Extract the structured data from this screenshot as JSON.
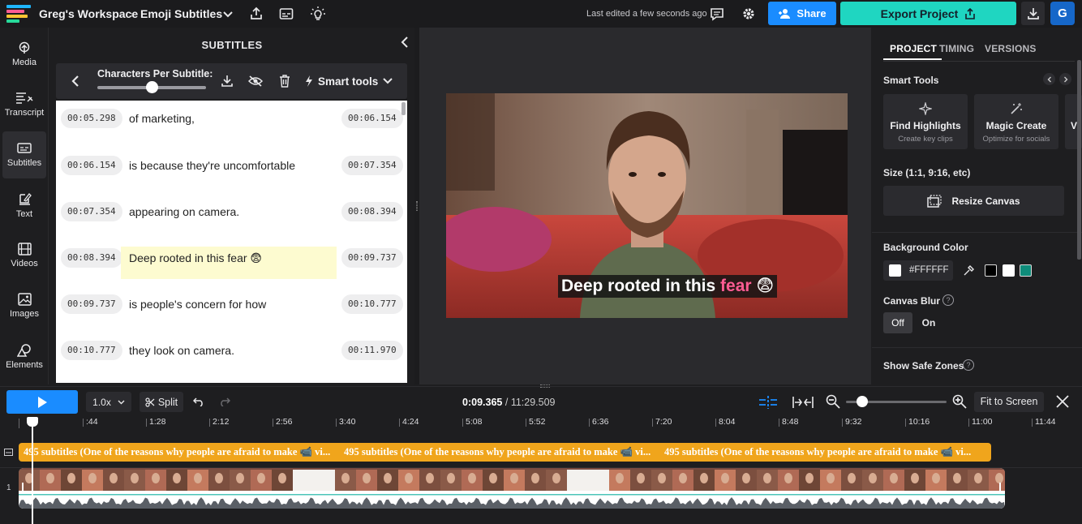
{
  "topbar": {
    "workspace": "Greg's Workspace",
    "separator": "›",
    "project_name": "Emoji Subtitles",
    "last_edited": "Last edited a few seconds ago",
    "share_label": "Share",
    "export_label": "Export Project",
    "avatar_letter": "G"
  },
  "rail": [
    {
      "label": "Media",
      "icon": "upload-icon"
    },
    {
      "label": "Transcript",
      "icon": "transcript-icon"
    },
    {
      "label": "Subtitles",
      "icon": "subtitles-icon"
    },
    {
      "label": "Text",
      "icon": "text-edit-icon"
    },
    {
      "label": "Videos",
      "icon": "film-icon"
    },
    {
      "label": "Images",
      "icon": "image-icon"
    },
    {
      "label": "Elements",
      "icon": "shapes-icon"
    }
  ],
  "subtitles_panel": {
    "title": "SUBTITLES",
    "chars_label": "Characters Per Subtitle:",
    "chars_slider_value": 0.5,
    "smart_tools_label": "Smart tools",
    "rows": [
      {
        "start": "00:05.298",
        "text": "of marketing,",
        "end": "00:06.154",
        "highlighted": false
      },
      {
        "start": "00:06.154",
        "text": "is because they're uncomfortable",
        "end": "00:07.354",
        "highlighted": false
      },
      {
        "start": "00:07.354",
        "text": "appearing on camera.",
        "end": "00:08.394",
        "highlighted": false
      },
      {
        "start": "00:08.394",
        "text": "Deep rooted in this fear 😨",
        "end": "00:09.737",
        "highlighted": true
      },
      {
        "start": "00:09.737",
        "text": "is people's concern for how",
        "end": "00:10.777",
        "highlighted": false
      },
      {
        "start": "00:10.777",
        "text": "they look on camera.",
        "end": "00:11.970",
        "highlighted": false
      }
    ]
  },
  "preview": {
    "caption_main": "Deep rooted in this",
    "caption_emph": "fear",
    "caption_emoji": "😨",
    "emph_color": "#ff5c93"
  },
  "right_panel": {
    "tabs": [
      "PROJECT",
      "TIMING",
      "VERSIONS"
    ],
    "active_tab": "PROJECT",
    "smart_tools_title": "Smart Tools",
    "cards": [
      {
        "title": "Find Highlights",
        "subtitle": "Create key clips",
        "icon": "sparkle-icon"
      },
      {
        "title": "Magic Create",
        "subtitle": "Optimize for socials",
        "icon": "magic-wand-icon"
      }
    ],
    "size_title": "Size (1:1, 9:16, etc)",
    "resize_label": "Resize Canvas",
    "bg_title": "Background Color",
    "bg_value": "#FFFFFF",
    "swatches": [
      "#000000",
      "#ffffff",
      "#0e8c7a"
    ],
    "blur_title": "Canvas Blur",
    "blur_off": "Off",
    "blur_on": "On",
    "safe_zones_title": "Show Safe Zones"
  },
  "timeline": {
    "speed": "1.0x",
    "split_label": "Split",
    "current_time": "0:09.365",
    "time_sep": "/",
    "total_time": "11:29.509",
    "fit_label": "Fit to Screen",
    "zoom_level": 0.16,
    "ruler_ticks": [
      ":44",
      "1:28",
      "2:12",
      "2:56",
      "3:40",
      "4:24",
      "5:08",
      "5:52",
      "6:36",
      "7:20",
      "8:04",
      "8:48",
      "9:32",
      "10:16",
      "11:00",
      "11:44"
    ],
    "subtitle_track_text": "495 subtitles (One of the reasons why people are afraid to make 📹 vi...",
    "subtitle_track_repeat": 3,
    "track_number": "1"
  },
  "colors": {
    "accent_blue": "#1a8cff",
    "export_teal": "#1fd6c1",
    "track_orange": "#f0a51c"
  }
}
